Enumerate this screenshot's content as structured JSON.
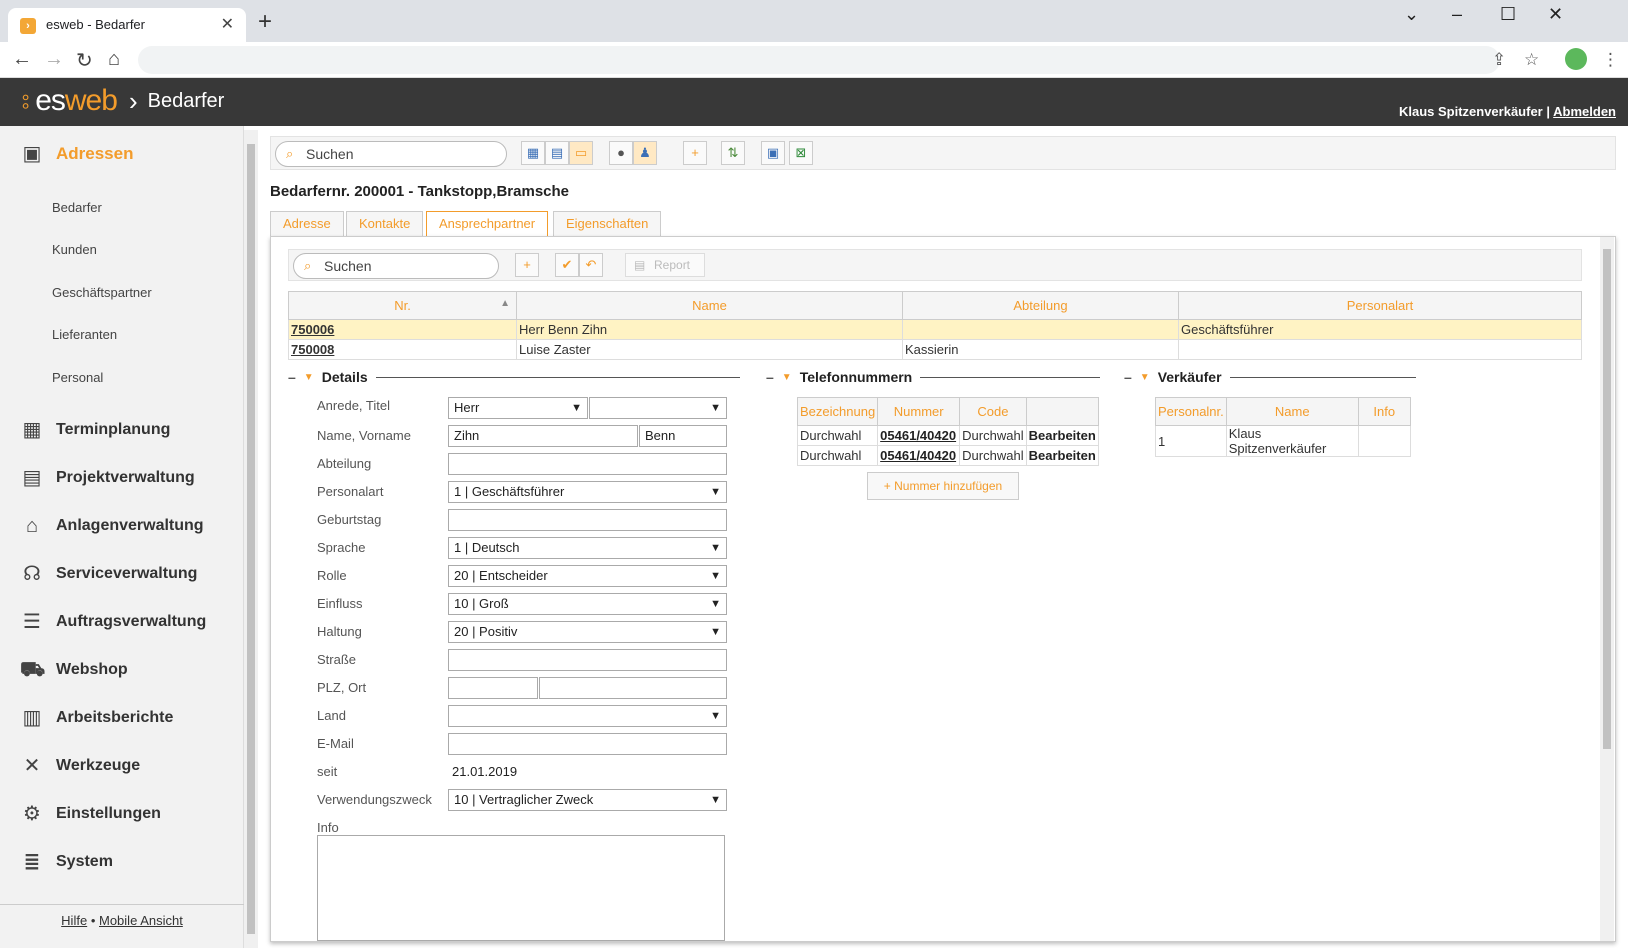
{
  "browser": {
    "tab_title": "esweb - Bedarfer",
    "new_tab": "+",
    "close": "✕"
  },
  "header": {
    "brand_es": "es",
    "brand_web": "web",
    "module": "Bedarfer",
    "user": "Klaus Spitzenverkäufer",
    "separator": "|",
    "logout": "Abmelden"
  },
  "sidebar": {
    "active": "Adressen",
    "sub_items": [
      "Bedarfer",
      "Kunden",
      "Geschäftspartner",
      "Lieferanten",
      "Personal"
    ],
    "items": [
      {
        "label": "Terminplanung",
        "icon": "calendar-icon"
      },
      {
        "label": "Projektverwaltung",
        "icon": "gantt-icon"
      },
      {
        "label": "Anlagenverwaltung",
        "icon": "factory-icon"
      },
      {
        "label": "Serviceverwaltung",
        "icon": "headset-icon"
      },
      {
        "label": "Auftragsverwaltung",
        "icon": "list-icon"
      },
      {
        "label": "Webshop",
        "icon": "cart-icon"
      },
      {
        "label": "Arbeitsberichte",
        "icon": "clipboard-icon"
      },
      {
        "label": "Werkzeuge",
        "icon": "tools-icon"
      },
      {
        "label": "Einstellungen",
        "icon": "gears-icon"
      },
      {
        "label": "System",
        "icon": "database-icon"
      }
    ],
    "footer_help": "Hilfe",
    "footer_dot": "•",
    "footer_mobile": "Mobile Ansicht"
  },
  "toolbar": {
    "search_placeholder": "Suchen"
  },
  "page": {
    "title": "Bedarfernr. 200001 - Tankstopp,Bramsche"
  },
  "tabs": [
    "Adresse",
    "Kontakte",
    "Ansprechpartner",
    "Eigenschaften"
  ],
  "inner_toolbar": {
    "search_placeholder": "Suchen",
    "report": "Report"
  },
  "contacts": {
    "columns": [
      "Nr.",
      "Name",
      "Abteilung",
      "Personalart"
    ],
    "rows": [
      {
        "nr": "750006",
        "name": "Herr Benn Zihn",
        "abteilung": "",
        "personalart": "Geschäftsführer"
      },
      {
        "nr": "750008",
        "name": "Luise Zaster",
        "abteilung": "Kassierin",
        "personalart": ""
      }
    ]
  },
  "details": {
    "heading": "Details",
    "labels": {
      "anrede": "Anrede, Titel",
      "name": "Name, Vorname",
      "abteilung": "Abteilung",
      "personalart": "Personalart",
      "geburtstag": "Geburtstag",
      "sprache": "Sprache",
      "rolle": "Rolle",
      "einfluss": "Einfluss",
      "haltung": "Haltung",
      "strasse": "Straße",
      "plz": "PLZ, Ort",
      "land": "Land",
      "email": "E-Mail",
      "seit": "seit",
      "verwendung": "Verwendungszweck",
      "info": "Info"
    },
    "values": {
      "anrede": "Herr",
      "titel": "",
      "name": "Zihn",
      "vorname": "Benn",
      "personalart": "1 | Geschäftsführer",
      "sprache": "1 | Deutsch",
      "rolle": "20 | Entscheider",
      "einfluss": "10 | Groß",
      "haltung": "20 | Positiv",
      "seit": "21.01.2019",
      "verwendung": "10 | Vertraglicher Zweck"
    }
  },
  "phones": {
    "heading": "Telefonnummern",
    "columns": [
      "Bezeichnung",
      "Nummer",
      "Code",
      ""
    ],
    "rows": [
      {
        "bez": "Durchwahl",
        "nummer": "05461/40420",
        "code": "Durchwahl",
        "action": "Bearbeiten"
      },
      {
        "bez": "Durchwahl",
        "nummer": "05461/40420",
        "code": "Durchwahl",
        "action": "Bearbeiten"
      }
    ],
    "add": "Nummer hinzufügen"
  },
  "sellers": {
    "heading": "Verkäufer",
    "columns": [
      "Personalnr.",
      "Name",
      "Info"
    ],
    "rows": [
      {
        "nr": "1",
        "name": "Klaus Spitzenverkäufer",
        "info": ""
      }
    ]
  },
  "colors": {
    "accent": "#f39c2b",
    "header_bg": "#383838",
    "selected_row": "#fff3c4"
  }
}
